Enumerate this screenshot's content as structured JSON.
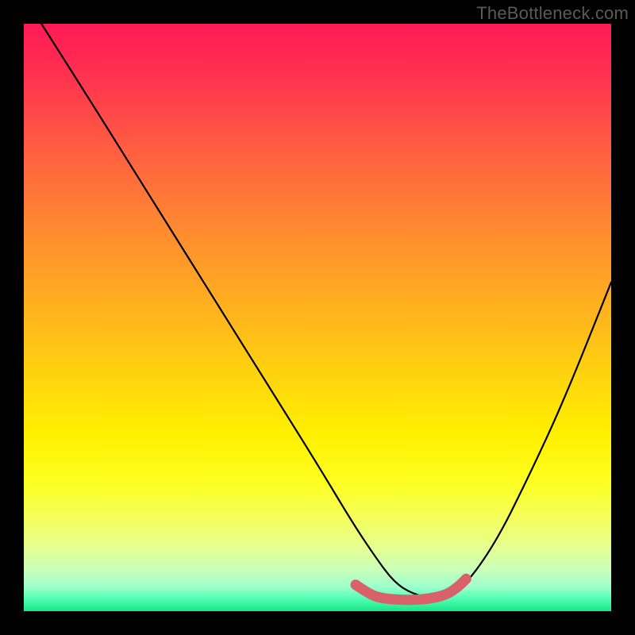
{
  "watermark": "TheBottleneck.com",
  "chart_data": {
    "type": "line",
    "title": "",
    "xlabel": "",
    "ylabel": "",
    "xlim": [
      0,
      100
    ],
    "ylim": [
      0,
      100
    ],
    "series": [
      {
        "name": "curve",
        "x": [
          3,
          10,
          20,
          30,
          40,
          50,
          56,
          60,
          63,
          66,
          70,
          74,
          80,
          86,
          92,
          100
        ],
        "y": [
          100,
          89,
          73,
          57,
          41,
          25,
          15,
          9,
          5,
          3,
          2,
          3,
          11,
          23,
          36,
          56
        ]
      }
    ],
    "highlight_segment": {
      "x": [
        56.5,
        59,
        61,
        63,
        66,
        69,
        72,
        74,
        75.3
      ],
      "y": [
        4.5,
        2.8,
        2.2,
        2,
        1.9,
        2.1,
        2.8,
        4.2,
        5.5
      ]
    },
    "colors": {
      "curve": "#000000",
      "highlight": "#d9616a",
      "gradient_top": "#ff1a56",
      "gradient_bottom": "#18e487"
    }
  }
}
